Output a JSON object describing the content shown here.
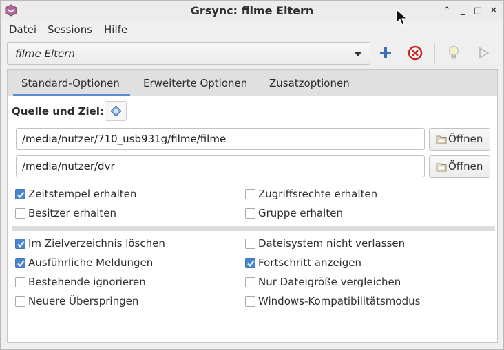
{
  "window": {
    "title": "Grsync: filme Eltern",
    "controls": [
      "⌃",
      "_",
      "□",
      "✕"
    ]
  },
  "menubar": {
    "items": [
      "Datei",
      "Sessions",
      "Hilfe"
    ]
  },
  "session": {
    "selected": "filme Eltern"
  },
  "toolbar": {
    "add": "add-session",
    "delete": "delete-session",
    "simulate": "simulate",
    "run": "run"
  },
  "tabs": [
    {
      "label": "Standard-Optionen",
      "active": true
    },
    {
      "label": "Erweiterte Optionen",
      "active": false
    },
    {
      "label": "Zusatzoptionen",
      "active": false
    }
  ],
  "source_dest": {
    "label": "Quelle und Ziel:",
    "source": "/media/nutzer/710_usb931g/filme/filme",
    "destination": "/media/nutzer/dvr",
    "open_label": "Öffnen"
  },
  "options_group1": [
    {
      "label": "Zeitstempel erhalten",
      "checked": true
    },
    {
      "label": "Zugriffsrechte erhalten",
      "checked": false
    },
    {
      "label": "Besitzer erhalten",
      "checked": false
    },
    {
      "label": "Gruppe erhalten",
      "checked": false
    }
  ],
  "options_group2": [
    {
      "label": "Im Zielverzeichnis löschen",
      "checked": true
    },
    {
      "label": "Dateisystem nicht verlassen",
      "checked": false
    },
    {
      "label": "Ausführliche Meldungen",
      "checked": true
    },
    {
      "label": "Fortschritt anzeigen",
      "checked": true
    },
    {
      "label": "Bestehende ignorieren",
      "checked": false
    },
    {
      "label": "Nur Dateigröße vergleichen",
      "checked": false
    },
    {
      "label": "Neuere Überspringen",
      "checked": false
    },
    {
      "label": "Windows-Kompatibilitätsmodus",
      "checked": false
    }
  ],
  "colors": {
    "accent": "#4a86cf",
    "tab_underline": "#5a8ed6"
  }
}
